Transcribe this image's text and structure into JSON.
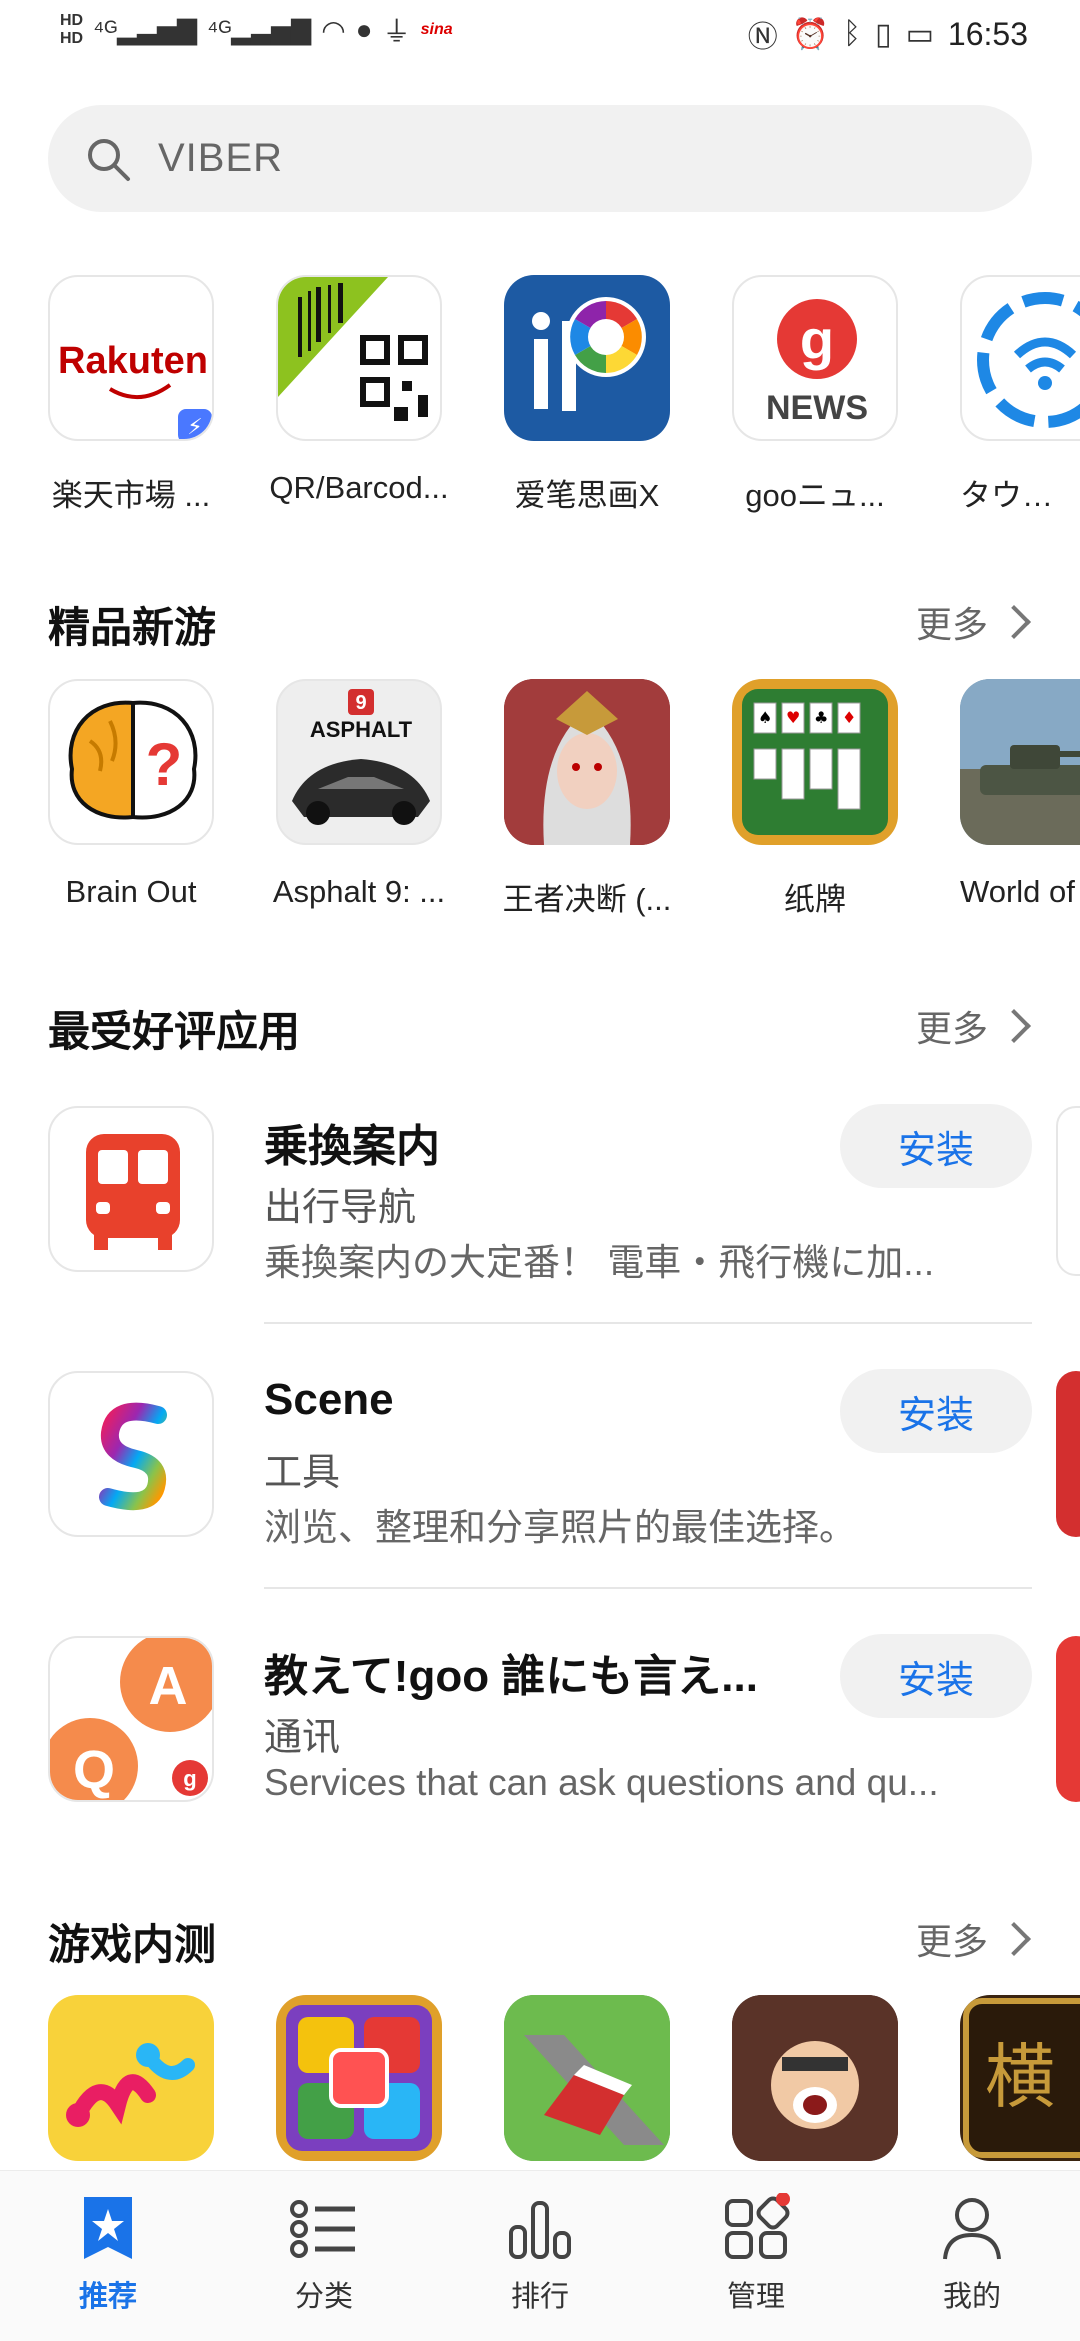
{
  "status_bar": {
    "left_icons": [
      "hd-icon",
      "signal-4g-icon",
      "signal-4g-icon",
      "wifi-icon",
      "globe-icon",
      "usb-icon",
      "sina-icon"
    ],
    "time": "16:53"
  },
  "search": {
    "placeholder": "VIBER"
  },
  "featured_apps": [
    {
      "name": "楽天市場 ..."
    },
    {
      "name": "QR/Barcod..."
    },
    {
      "name": "爱笔思画X"
    },
    {
      "name": "gooニュ..."
    },
    {
      "name": "タウンW"
    }
  ],
  "new_games": {
    "title": "精品新游",
    "more": "更多",
    "items": [
      {
        "name": "Brain Out"
      },
      {
        "name": "Asphalt 9: ..."
      },
      {
        "name": "王者决断 (..."
      },
      {
        "name": "纸牌"
      },
      {
        "name": "World of"
      }
    ]
  },
  "top_rated": {
    "title": "最受好评应用",
    "more": "更多",
    "items": [
      {
        "title": "乗換案内",
        "category": "出行导航",
        "desc": "乗換案内の大定番！ 電車・飛行機に加...",
        "button": "安装"
      },
      {
        "title": "Scene",
        "category": "工具",
        "desc": "浏览、整理和分享照片的最佳选择。",
        "button": "安装"
      },
      {
        "title": "教えて!goo 誰にも言え...",
        "category": "通讯",
        "desc": "Services that can ask questions and qu...",
        "button": "安装"
      }
    ]
  },
  "beta_games": {
    "title": "游戏内测",
    "more": "更多"
  },
  "bottom_nav": [
    {
      "label": "推荐",
      "icon": "star-bookmark-icon",
      "active": true
    },
    {
      "label": "分类",
      "icon": "list-icon",
      "active": false
    },
    {
      "label": "排行",
      "icon": "bar-chart-icon",
      "active": false
    },
    {
      "label": "管理",
      "icon": "grid-manage-icon",
      "active": false
    },
    {
      "label": "我的",
      "icon": "person-icon",
      "active": false
    }
  ],
  "colors": {
    "accent": "#1a73e8",
    "badge": "#e53935"
  }
}
